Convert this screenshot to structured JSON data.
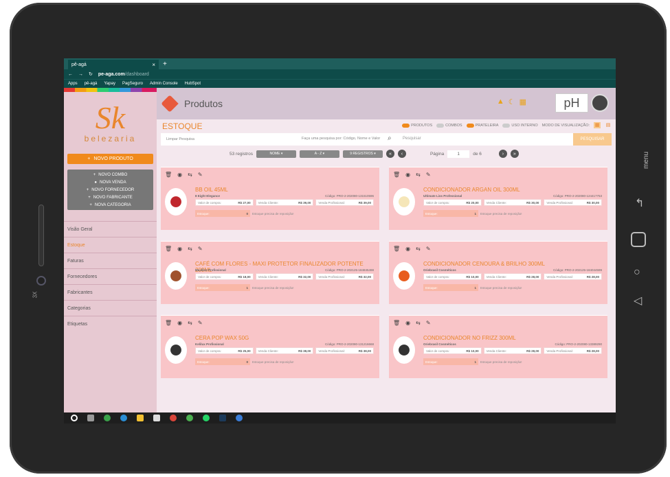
{
  "browser": {
    "tab_title": "pê-agá",
    "url_host": "pe-aga.com",
    "url_path": "/dashboard",
    "bookmarks": [
      "Apps",
      "pê-agá",
      "Yapay",
      "PagSeguro",
      "Admin Console",
      "HubSpot"
    ]
  },
  "sidebar": {
    "logo_mark": "Sk",
    "logo_word": "belezaria",
    "new_product": "NOVO PRODUTO",
    "submenu": [
      "NOVO COMBO",
      "NOVA VENDA",
      "NOVO FORNECEDOR",
      "NOVO FABRICANTE",
      "NOVA CATEGORIA"
    ],
    "nav": [
      "Visão Geral",
      "Estoque",
      "Faturas",
      "Fornecedores",
      "Fabricantes",
      "Categorias",
      "Etiquetas"
    ]
  },
  "header": {
    "title": "Produtos",
    "brand": "pH"
  },
  "estoque": {
    "title": "ESTOQUE",
    "toggles": [
      "PRODUTOS",
      "COMBOS",
      "PRATELEIRA",
      "USO INTERNO"
    ],
    "view_mode": "MODO DE VISUALIZAÇÃO:"
  },
  "search": {
    "clear": "Limpar Pesquisa",
    "hint": "Faça uma pesquisa por: Código, Nome e Valor",
    "placeholder": "Pesquisar",
    "button": "PESQUISAR"
  },
  "pagination": {
    "records": "53 registros",
    "sort1": "NOME",
    "sort2": "A - Z",
    "per_page": "9 REGISTROS",
    "page_label": "Página",
    "page": "1",
    "of": "de 6"
  },
  "labels": {
    "valor_compra": "Valor de compra:",
    "venda_cliente": "Venda Cliente:",
    "venda_prof": "Venda Profissional:",
    "estoque": "Estoque:",
    "reposicao": "Estoque precisa de reposição!"
  },
  "products": [
    {
      "name": "BB OIL 45ML",
      "brand": "8 Eight Elegance",
      "code": "Código: PRO-2-202080-131510596",
      "compra": "R$ 27,00",
      "cliente": "R$ 39,00",
      "prof": "R$ 39,00",
      "stock": "0"
    },
    {
      "name": "CONDICIONADOR ARGAN OIL 300ML",
      "brand": "Ultimate Liss Professional",
      "code": "Código: PRO-2-202080-124417753",
      "compra": "R$ 20,00",
      "cliente": "R$ 30,00",
      "prof": "R$ 30,00",
      "stock": "1"
    },
    {
      "name": "CAFÉ COM FLORES - MAXI PROTETOR FINALIZADOR POTENTE 200ML",
      "brand": "Maxiline Profissional",
      "code": "Código: PRO-2-202125-184845498",
      "compra": "R$ 18,00",
      "cliente": "R$ 32,00",
      "prof": "R$ 32,00",
      "stock": "1"
    },
    {
      "name": "CONDICIONADOR CENOURA & BRILHO 300ML",
      "brand": "Oriebrasil Cosméticos",
      "code": "Código: PRO-2-202125-184044599",
      "compra": "R$ 10,00",
      "cliente": "R$ 28,00",
      "prof": "R$ 28,00",
      "stock": "1"
    },
    {
      "name": "CERA POP WAX 50G",
      "brand": "Kelilux Profissional",
      "code": "Código: PRO-2-202080-131216668",
      "compra": "R$ 25,00",
      "cliente": "R$ 38,00",
      "prof": "R$ 38,00",
      "stock": "0"
    },
    {
      "name": "CONDICIONADOR NO FRIZZ 300ML",
      "brand": "Oriebrasil Cosméticos",
      "code": "Código: PRO-2-202080-13389290",
      "compra": "R$ 10,00",
      "cliente": "R$ 28,00",
      "prof": "R$ 28,00",
      "stock": "1"
    }
  ]
}
